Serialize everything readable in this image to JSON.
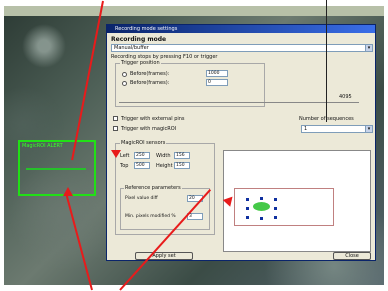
{
  "window": {
    "title": "Recording mode settings",
    "recording_mode_label": "Recording mode",
    "mode_value": "Manual/buffer",
    "recording_note": "Recording stops by pressing F10 or trigger",
    "trigger_group_label": "Trigger position",
    "before_trigger_label": "Before(frames):",
    "before_trigger_value": "1000",
    "after_trigger_label": "Before(frames):",
    "after_trigger_value": "0",
    "trigger_slider_max": "4095",
    "external_trigger_label": "Trigger with external pins",
    "magic_roi_trigger_label": "Trigger with magicROI",
    "frames_sequence_label": "Number of sequences",
    "frames_sequence_value": "1"
  },
  "magicroi": {
    "group_label": "MagicROI sensors",
    "left_label": "Left",
    "left_value": "250",
    "width_label": "Width",
    "width_value": "156",
    "top_label": "Top",
    "top_value": "500",
    "height_label": "Height",
    "height_value": "150",
    "ref_group_label": "Reference parameters",
    "pixel_value_label": "Pixel value diff",
    "pixel_value": "20",
    "min_pixels_label": "Min. pixels modified %",
    "min_pixels_value": "3"
  },
  "overlay": {
    "roi_label": "MagicROI ALERT"
  },
  "footer": {
    "apply_label": "Apply set",
    "close_label": "Close"
  },
  "colors": {
    "roi_box": "#21e016",
    "arrow": "#e81b1b",
    "titlebar": "#0a246a"
  }
}
